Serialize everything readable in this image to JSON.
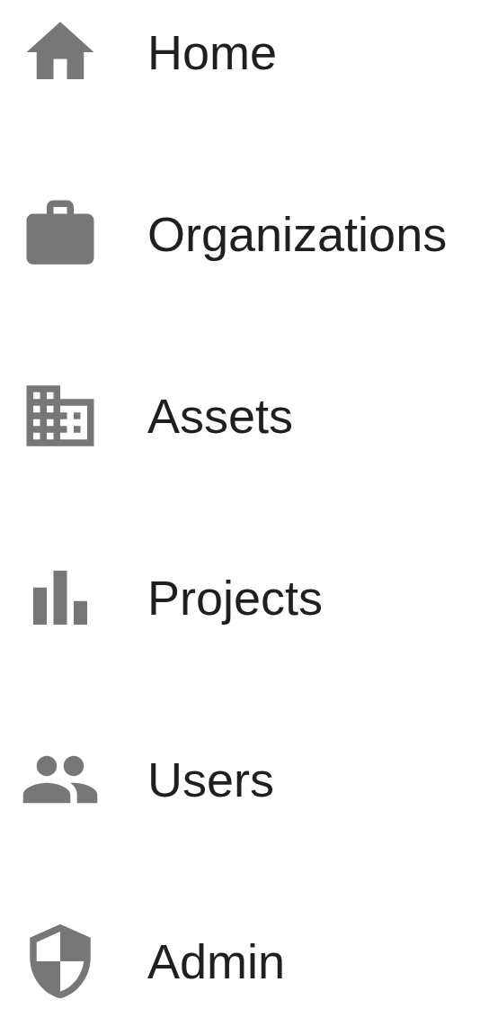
{
  "nav": [
    {
      "label": "Home",
      "kind": "home"
    },
    {
      "label": "Organizations",
      "kind": "organizations"
    },
    {
      "label": "Assets",
      "kind": "assets"
    },
    {
      "label": "Projects",
      "kind": "projects"
    },
    {
      "label": "Users",
      "kind": "users"
    },
    {
      "label": "Admin",
      "kind": "admin"
    }
  ]
}
